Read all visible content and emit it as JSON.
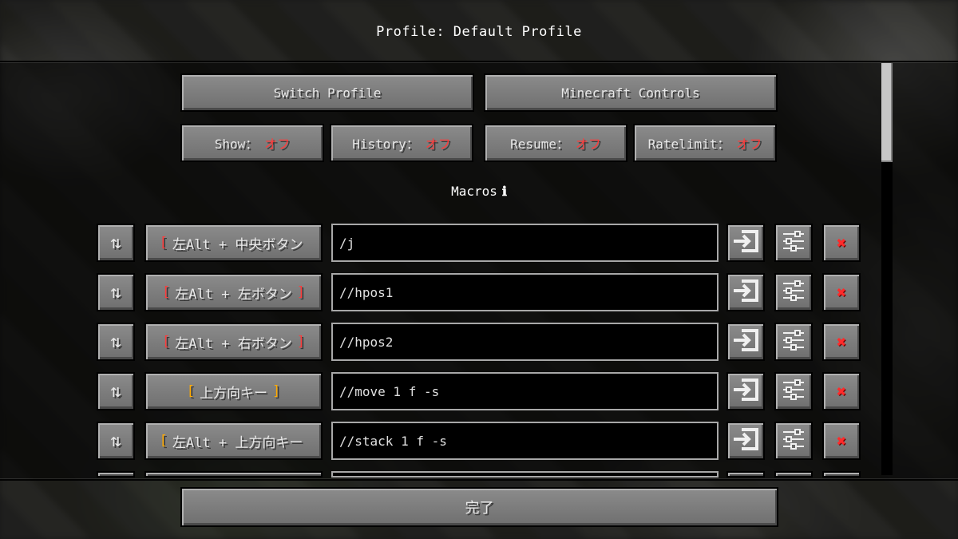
{
  "title": "Profile: Default Profile",
  "buttons": {
    "switch_profile": "Switch Profile",
    "minecraft_controls": "Minecraft Controls",
    "done": "完了"
  },
  "toggles": [
    {
      "label": "Show：",
      "value": "オフ"
    },
    {
      "label": "History：",
      "value": "オフ"
    },
    {
      "label": "Resume：",
      "value": "オフ"
    },
    {
      "label": "Ratelimit：",
      "value": "オフ"
    }
  ],
  "section": {
    "title": "Macros",
    "info": "ℹ"
  },
  "macros": [
    {
      "key_open": "[",
      "key": "左Alt + 中央ボタン",
      "key_close": "",
      "command": "/j"
    },
    {
      "key_open": "[",
      "key": "左Alt + 左ボタン",
      "key_close": "]",
      "command": "//hpos1"
    },
    {
      "key_open": "[",
      "key": "左Alt + 右ボタン",
      "key_close": "]",
      "command": "//hpos2"
    },
    {
      "key_open": "[",
      "key": "上方向キー",
      "key_close": "]",
      "command": "//move 1 f -s"
    },
    {
      "key_open": "[",
      "key": "左Alt + 上方向キー",
      "key_close": "",
      "command": "//stack 1 f -s"
    }
  ],
  "icons": {
    "sort": "⇅",
    "execute": "execute-icon",
    "config": "sliders-icon",
    "delete": "✖"
  },
  "colors": {
    "off": "#ff3a3a",
    "bracket_red": "#ff3a3a",
    "bracket_gold": "#ffaa00",
    "delete_x": "#ff2a2a"
  },
  "scroll": {
    "position_fraction": 0
  }
}
